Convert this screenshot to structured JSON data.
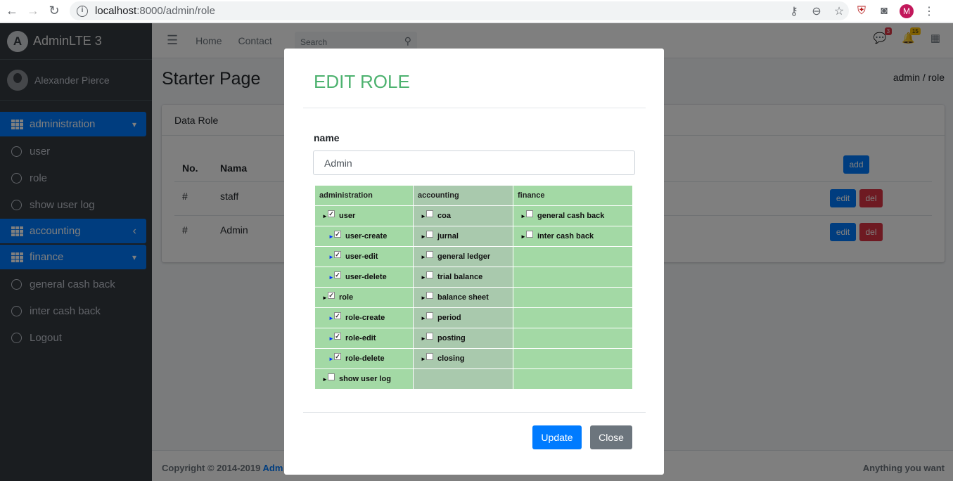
{
  "browser": {
    "url_host": "localhost",
    "url_rest": ":8000/admin/role",
    "profile_initial": "M"
  },
  "sidebar": {
    "brand": "AdminLTE 3",
    "user": "Alexander Pierce",
    "items": [
      {
        "label": "administration",
        "type": "group",
        "caret": "▾"
      },
      {
        "label": "user",
        "type": "link"
      },
      {
        "label": "role",
        "type": "link"
      },
      {
        "label": "show user log",
        "type": "link"
      },
      {
        "label": "accounting",
        "type": "group",
        "caret": "‹"
      },
      {
        "label": "finance",
        "type": "group",
        "caret": "▾"
      },
      {
        "label": "general cash back",
        "type": "link"
      },
      {
        "label": "inter cash back",
        "type": "link"
      },
      {
        "label": "Logout",
        "type": "link"
      }
    ]
  },
  "topnav": {
    "home": "Home",
    "contact": "Contact",
    "search_placeholder": "Search",
    "messages_count": "3",
    "notifications_count": "15"
  },
  "page": {
    "title": "Starter Page",
    "breadcrumb": "admin  /  role"
  },
  "card": {
    "title": "Data Role",
    "headers": {
      "no": "No.",
      "nama": "Nama"
    },
    "add_label": "add",
    "rows": [
      {
        "no": "#",
        "nama": "staff",
        "edit": "edit",
        "del": "del"
      },
      {
        "no": "#",
        "nama": "Admin",
        "edit": "edit",
        "del": "del"
      }
    ]
  },
  "footer": {
    "copyright": "Copyright © 2014-2019 ",
    "link": "Adm",
    "right": "Anything you want"
  },
  "modal": {
    "title": "EDIT ROLE",
    "name_label": "name",
    "name_value": "Admin",
    "update_label": "Update",
    "close_label": "Close",
    "columns": [
      "administration",
      "accounting",
      "finance"
    ],
    "administration": [
      {
        "label": "user",
        "level": 0,
        "checked": true
      },
      {
        "label": "user-create",
        "level": 1,
        "checked": true
      },
      {
        "label": "user-edit",
        "level": 1,
        "checked": true
      },
      {
        "label": "user-delete",
        "level": 1,
        "checked": true
      },
      {
        "label": "role",
        "level": 0,
        "checked": true
      },
      {
        "label": "role-create",
        "level": 1,
        "checked": true
      },
      {
        "label": "role-edit",
        "level": 1,
        "checked": true
      },
      {
        "label": "role-delete",
        "level": 1,
        "checked": true
      },
      {
        "label": "show user log",
        "level": 0,
        "checked": false
      }
    ],
    "accounting": [
      {
        "label": "coa",
        "checked": false
      },
      {
        "label": "jurnal",
        "checked": false
      },
      {
        "label": "general ledger",
        "checked": false
      },
      {
        "label": "trial balance",
        "checked": false
      },
      {
        "label": "balance sheet",
        "checked": false
      },
      {
        "label": "period",
        "checked": false
      },
      {
        "label": "posting",
        "checked": false
      },
      {
        "label": "closing",
        "checked": false
      }
    ],
    "finance": [
      {
        "label": "general cash back",
        "checked": false
      },
      {
        "label": "inter cash back",
        "checked": false
      }
    ]
  },
  "colors": {
    "primary": "#007bff",
    "danger": "#dc3545",
    "modal_title": "#4db26f",
    "sidebar_bg": "#343a40"
  }
}
